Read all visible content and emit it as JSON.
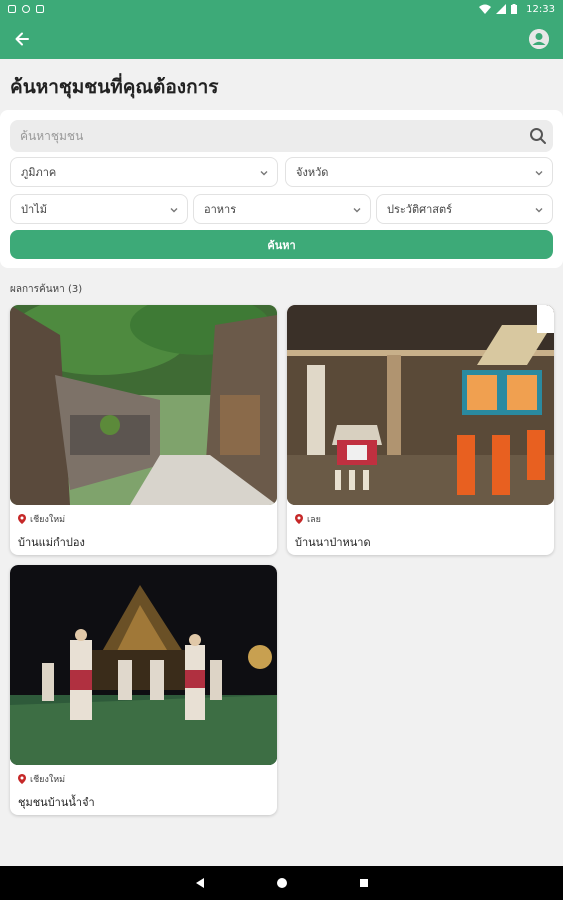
{
  "status_bar": {
    "time": "12:33"
  },
  "app_bar": {
    "back_icon": "arrow-left-icon",
    "account_icon": "account-circle-icon"
  },
  "page": {
    "title": "ค้นหาชุมชนที่คุณต้องการ"
  },
  "search": {
    "placeholder": "ค้นหาชุมชน",
    "icon": "search-icon",
    "filters": [
      {
        "label": "ภูมิภาค"
      },
      {
        "label": "จังหวัด"
      },
      {
        "label": "ป่าไม้"
      },
      {
        "label": "อาหาร"
      },
      {
        "label": "ประวัติศาสตร์"
      }
    ],
    "button_label": "ค้นหา"
  },
  "results": {
    "label": "ผลการค้นหา (3)",
    "items": [
      {
        "province": "เชียงใหม่",
        "name": "บ้านแม่กำปอง"
      },
      {
        "province": "เลย",
        "name": "บ้านนาป่าหนาด"
      },
      {
        "province": "เชียงใหม่",
        "name": "ชุมชนบ้านน้ำจำ"
      }
    ]
  },
  "colors": {
    "primary": "#3daa78",
    "pin": "#c62828"
  }
}
